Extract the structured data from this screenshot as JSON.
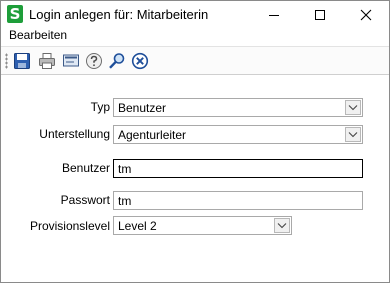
{
  "window": {
    "app_icon_letter": "S",
    "title": "Login anlegen für: Mitarbeiterin"
  },
  "menu": {
    "items": [
      {
        "label": "Bearbeiten"
      }
    ]
  },
  "toolbar": {
    "buttons": [
      {
        "icon": "save-icon"
      },
      {
        "icon": "print-icon"
      },
      {
        "icon": "screen-icon"
      },
      {
        "icon": "help-icon"
      },
      {
        "icon": "search-icon"
      },
      {
        "icon": "cancel-icon"
      }
    ]
  },
  "form": {
    "typ": {
      "label": "Typ",
      "value": "Benutzer"
    },
    "unterstellung": {
      "label": "Unterstellung",
      "value": "Agenturleiter"
    },
    "benutzer": {
      "label": "Benutzer",
      "value": "tm"
    },
    "passwort": {
      "label": "Passwort",
      "value": "tm"
    },
    "provisionslevel": {
      "label": "Provisionslevel",
      "value": "Level 2"
    }
  },
  "colors": {
    "app_icon": "#1e9e3a",
    "field_border": "#a9a9a9",
    "focused_border": "#000000"
  }
}
